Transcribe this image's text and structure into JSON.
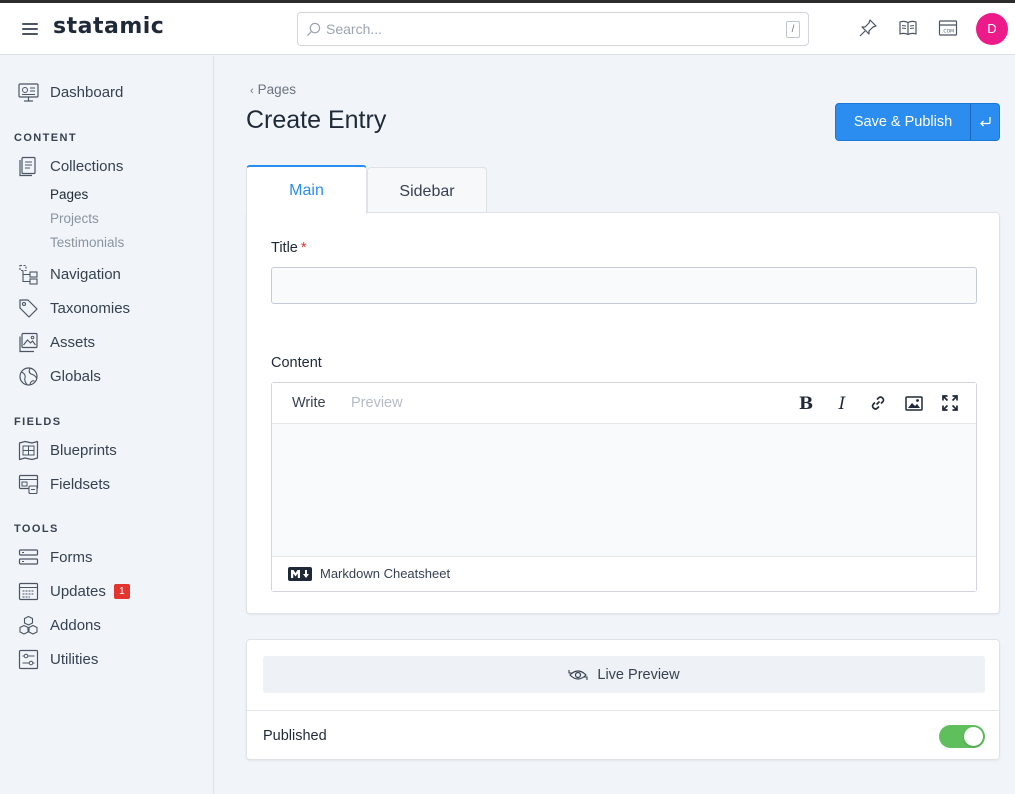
{
  "app": {
    "logo": "statamic"
  },
  "header": {
    "search_placeholder": "Search...",
    "search_shortcut": "/",
    "avatar_initial": "D",
    "avatar_color": "#ec1b89"
  },
  "sidebar": {
    "dashboard": "Dashboard",
    "sections": {
      "content": "CONTENT",
      "fields": "FIELDS",
      "tools": "TOOLS"
    },
    "collections": "Collections",
    "collection_items": [
      "Pages",
      "Projects",
      "Testimonials"
    ],
    "navigation": "Navigation",
    "taxonomies": "Taxonomies",
    "assets": "Assets",
    "globals": "Globals",
    "blueprints": "Blueprints",
    "fieldsets": "Fieldsets",
    "forms": "Forms",
    "updates": "Updates",
    "updates_badge": "1",
    "addons": "Addons",
    "utilities": "Utilities"
  },
  "page": {
    "breadcrumb": "Pages",
    "title": "Create Entry",
    "save_label": "Save & Publish",
    "accent_color": "#2b8def"
  },
  "tabs": [
    "Main",
    "Sidebar"
  ],
  "form": {
    "title_label": "Title",
    "title_required_marker": "*",
    "title_value": "",
    "content_label": "Content",
    "editor_tabs": {
      "write": "Write",
      "preview": "Preview"
    },
    "editor_value": "",
    "cheatsheet_link": "Markdown Cheatsheet"
  },
  "publish": {
    "live_preview_label": "Live Preview",
    "published_label": "Published",
    "published": true,
    "toggle_color": "#5fbf5c"
  }
}
